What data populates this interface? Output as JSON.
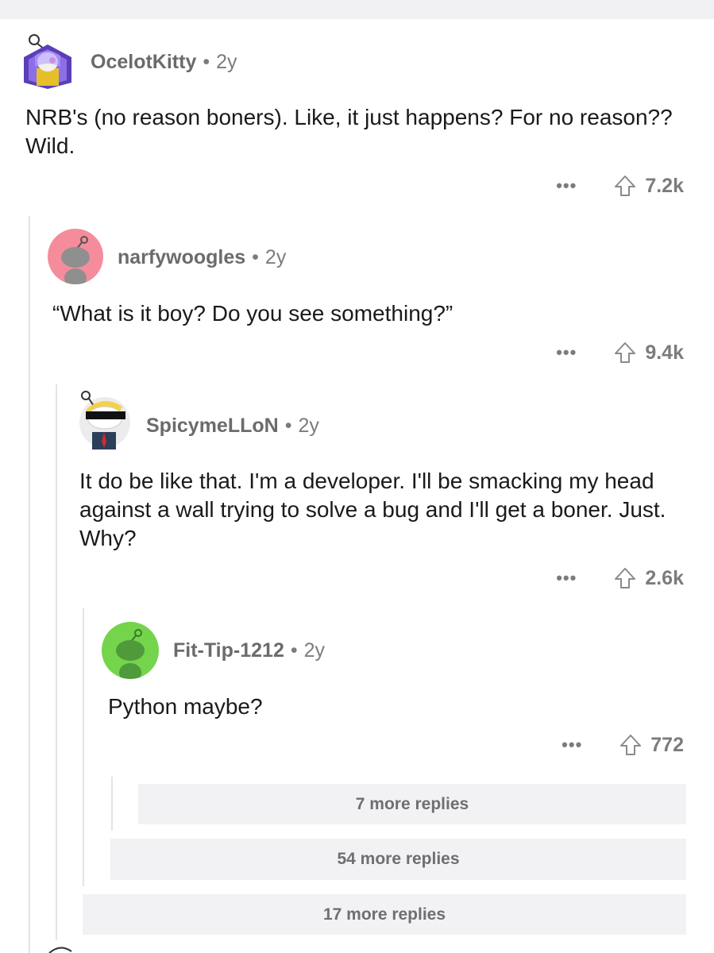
{
  "comments": [
    {
      "user": "OcelotKitty",
      "age": "2y",
      "text": "NRB's (no reason boners). Like, it just happens? For no reason?? Wild.",
      "votes": "7.2k",
      "avatar_color": "#7b4fd6"
    },
    {
      "user": "narfywoogles",
      "age": "2y",
      "text": "“What is it boy? Do you see something?”",
      "votes": "9.4k",
      "avatar_color": "#f58c9c"
    },
    {
      "user": "SpicymeLLoN",
      "age": "2y",
      "text": "It do be like that. I'm a developer. I'll be smacking my head against a wall trying to solve a bug and I'll get a boner. Just. Why?",
      "votes": "2.6k",
      "avatar_color": "#f2f2f2"
    },
    {
      "user": "Fit-Tip-1212",
      "age": "2y",
      "text": "Python maybe?",
      "votes": "772",
      "avatar_color": "#74d44c"
    }
  ],
  "more_replies": [
    "7 more replies",
    "54 more replies",
    "17 more replies"
  ],
  "dot_separator": "•",
  "more_options": "•••",
  "icons": {
    "upvote": "upvote-arrow-icon",
    "options": "more-options-icon"
  }
}
